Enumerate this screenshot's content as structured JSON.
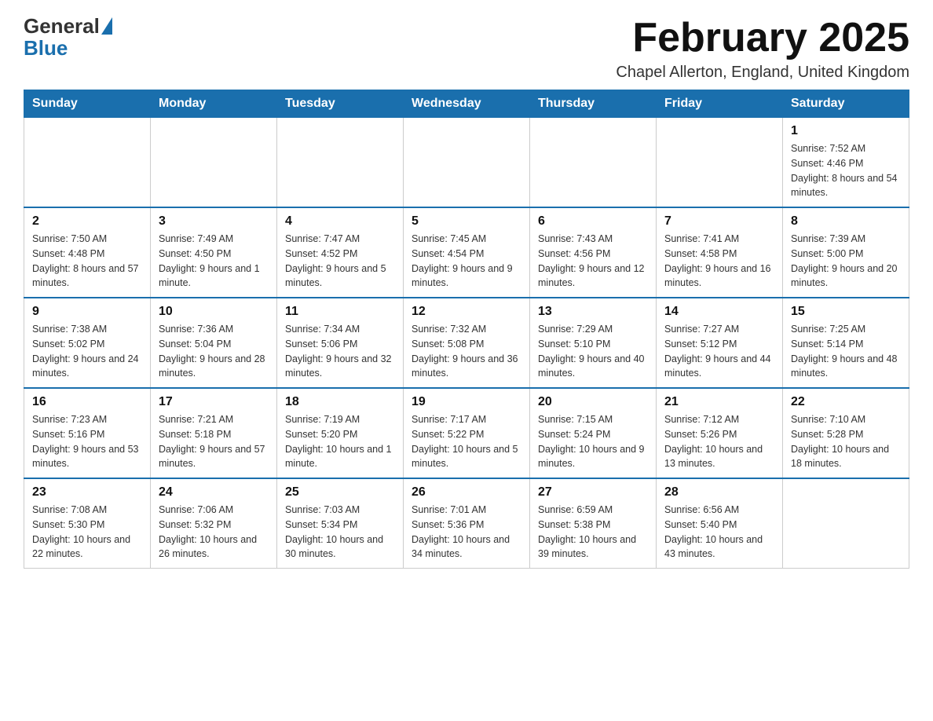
{
  "header": {
    "logo_text_general": "General",
    "logo_text_blue": "Blue",
    "title": "February 2025",
    "subtitle": "Chapel Allerton, England, United Kingdom"
  },
  "days_of_week": [
    "Sunday",
    "Monday",
    "Tuesday",
    "Wednesday",
    "Thursday",
    "Friday",
    "Saturday"
  ],
  "weeks": [
    [
      {
        "day": "",
        "info": ""
      },
      {
        "day": "",
        "info": ""
      },
      {
        "day": "",
        "info": ""
      },
      {
        "day": "",
        "info": ""
      },
      {
        "day": "",
        "info": ""
      },
      {
        "day": "",
        "info": ""
      },
      {
        "day": "1",
        "info": "Sunrise: 7:52 AM\nSunset: 4:46 PM\nDaylight: 8 hours and 54 minutes."
      }
    ],
    [
      {
        "day": "2",
        "info": "Sunrise: 7:50 AM\nSunset: 4:48 PM\nDaylight: 8 hours and 57 minutes."
      },
      {
        "day": "3",
        "info": "Sunrise: 7:49 AM\nSunset: 4:50 PM\nDaylight: 9 hours and 1 minute."
      },
      {
        "day": "4",
        "info": "Sunrise: 7:47 AM\nSunset: 4:52 PM\nDaylight: 9 hours and 5 minutes."
      },
      {
        "day": "5",
        "info": "Sunrise: 7:45 AM\nSunset: 4:54 PM\nDaylight: 9 hours and 9 minutes."
      },
      {
        "day": "6",
        "info": "Sunrise: 7:43 AM\nSunset: 4:56 PM\nDaylight: 9 hours and 12 minutes."
      },
      {
        "day": "7",
        "info": "Sunrise: 7:41 AM\nSunset: 4:58 PM\nDaylight: 9 hours and 16 minutes."
      },
      {
        "day": "8",
        "info": "Sunrise: 7:39 AM\nSunset: 5:00 PM\nDaylight: 9 hours and 20 minutes."
      }
    ],
    [
      {
        "day": "9",
        "info": "Sunrise: 7:38 AM\nSunset: 5:02 PM\nDaylight: 9 hours and 24 minutes."
      },
      {
        "day": "10",
        "info": "Sunrise: 7:36 AM\nSunset: 5:04 PM\nDaylight: 9 hours and 28 minutes."
      },
      {
        "day": "11",
        "info": "Sunrise: 7:34 AM\nSunset: 5:06 PM\nDaylight: 9 hours and 32 minutes."
      },
      {
        "day": "12",
        "info": "Sunrise: 7:32 AM\nSunset: 5:08 PM\nDaylight: 9 hours and 36 minutes."
      },
      {
        "day": "13",
        "info": "Sunrise: 7:29 AM\nSunset: 5:10 PM\nDaylight: 9 hours and 40 minutes."
      },
      {
        "day": "14",
        "info": "Sunrise: 7:27 AM\nSunset: 5:12 PM\nDaylight: 9 hours and 44 minutes."
      },
      {
        "day": "15",
        "info": "Sunrise: 7:25 AM\nSunset: 5:14 PM\nDaylight: 9 hours and 48 minutes."
      }
    ],
    [
      {
        "day": "16",
        "info": "Sunrise: 7:23 AM\nSunset: 5:16 PM\nDaylight: 9 hours and 53 minutes."
      },
      {
        "day": "17",
        "info": "Sunrise: 7:21 AM\nSunset: 5:18 PM\nDaylight: 9 hours and 57 minutes."
      },
      {
        "day": "18",
        "info": "Sunrise: 7:19 AM\nSunset: 5:20 PM\nDaylight: 10 hours and 1 minute."
      },
      {
        "day": "19",
        "info": "Sunrise: 7:17 AM\nSunset: 5:22 PM\nDaylight: 10 hours and 5 minutes."
      },
      {
        "day": "20",
        "info": "Sunrise: 7:15 AM\nSunset: 5:24 PM\nDaylight: 10 hours and 9 minutes."
      },
      {
        "day": "21",
        "info": "Sunrise: 7:12 AM\nSunset: 5:26 PM\nDaylight: 10 hours and 13 minutes."
      },
      {
        "day": "22",
        "info": "Sunrise: 7:10 AM\nSunset: 5:28 PM\nDaylight: 10 hours and 18 minutes."
      }
    ],
    [
      {
        "day": "23",
        "info": "Sunrise: 7:08 AM\nSunset: 5:30 PM\nDaylight: 10 hours and 22 minutes."
      },
      {
        "day": "24",
        "info": "Sunrise: 7:06 AM\nSunset: 5:32 PM\nDaylight: 10 hours and 26 minutes."
      },
      {
        "day": "25",
        "info": "Sunrise: 7:03 AM\nSunset: 5:34 PM\nDaylight: 10 hours and 30 minutes."
      },
      {
        "day": "26",
        "info": "Sunrise: 7:01 AM\nSunset: 5:36 PM\nDaylight: 10 hours and 34 minutes."
      },
      {
        "day": "27",
        "info": "Sunrise: 6:59 AM\nSunset: 5:38 PM\nDaylight: 10 hours and 39 minutes."
      },
      {
        "day": "28",
        "info": "Sunrise: 6:56 AM\nSunset: 5:40 PM\nDaylight: 10 hours and 43 minutes."
      },
      {
        "day": "",
        "info": ""
      }
    ]
  ]
}
